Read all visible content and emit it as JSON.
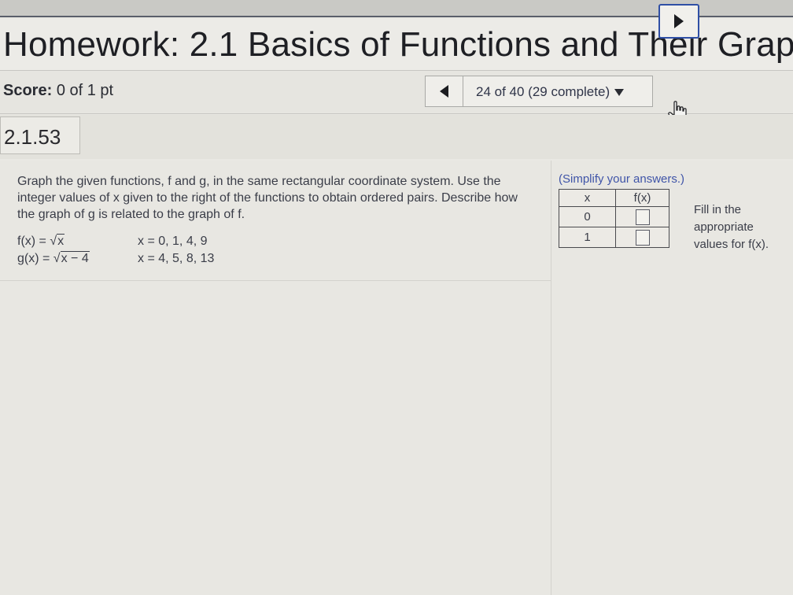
{
  "header": {
    "title": "Homework: 2.1 Basics of Functions and Their Grap"
  },
  "score": {
    "label": "Score:",
    "value": "0 of 1 pt"
  },
  "navigation": {
    "position": "24 of 40 (29 complete)",
    "prev_icon": "triangle-left-icon",
    "next_icon": "triangle-right-icon",
    "dropdown_icon": "triangle-down-icon",
    "cursor_icon": "hand-pointer-icon"
  },
  "question": {
    "number": "2.1.53",
    "prompt": "Graph the given functions, f and g, in the same rectangular coordinate system. Use the integer values of x given to the right of the functions to obtain ordered pairs. Describe how the graph of g is related to the graph of f.",
    "functions": [
      {
        "name": "f(x) =",
        "radicand": "x",
        "x_values": "x = 0, 1, 4, 9"
      },
      {
        "name": "g(x) =",
        "radicand": "x − 4",
        "x_values": "x = 4, 5, 8, 13"
      }
    ]
  },
  "answer_panel": {
    "instruction": "(Simplify your answers.)",
    "table": {
      "headers": [
        "x",
        "f(x)"
      ],
      "rows": [
        {
          "x": "0",
          "fx": ""
        },
        {
          "x": "1",
          "fx": ""
        }
      ]
    },
    "hint": "Fill in the appropriate values for f(x)."
  },
  "colors": {
    "accent_blue": "#2f4fa5",
    "link_blue": "#3f54a8",
    "background": "#e9e8e3"
  }
}
